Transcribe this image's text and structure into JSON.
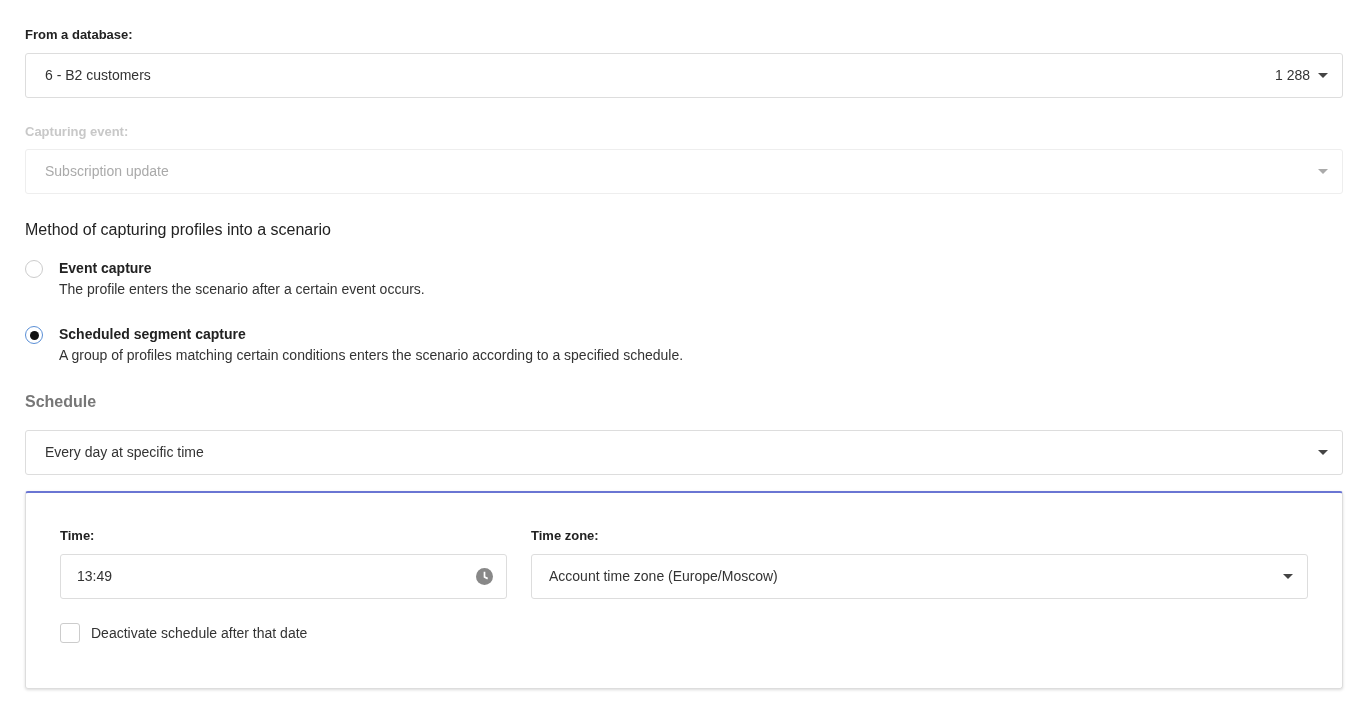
{
  "database": {
    "label": "From a database:",
    "value": "6 - B2 customers",
    "count": "1 288",
    "disabled": false
  },
  "capturing_event": {
    "label": "Capturing event:",
    "value": "Subscription update",
    "disabled": true
  },
  "method": {
    "title": "Method of capturing profiles into a scenario",
    "options": [
      {
        "label": "Event capture",
        "description": "The profile enters the scenario after a certain event occurs.",
        "selected": false
      },
      {
        "label": "Scheduled segment capture",
        "description": "A group of profiles matching certain conditions enters the scenario according to a specified schedule.",
        "selected": true
      }
    ]
  },
  "schedule": {
    "title": "Schedule",
    "value": "Every day at specific time",
    "time": {
      "label": "Time:",
      "value": "13:49"
    },
    "timezone": {
      "label": "Time zone:",
      "value": "Account time zone (Europe/Moscow)"
    },
    "deactivate": {
      "label": "Deactivate schedule after that date",
      "checked": false
    }
  }
}
